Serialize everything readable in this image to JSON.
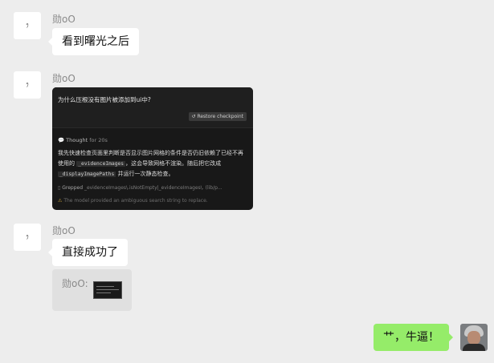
{
  "sender": {
    "name": "勋oO",
    "avatar_text": "ﾗ"
  },
  "messages": [
    {
      "text": "看到曙光之后"
    },
    {
      "screenshot": {
        "question": "为什么压根没有图片被添加到ui中?",
        "restore_label": "Restore checkpoint",
        "thought_label": "Thought",
        "thought_time": "for 20s",
        "body_parts": [
          "我先快速检查页面里判断是否显示图片网格的条件是否仍旧依赖了已经不再使用的 ",
          "_evidenceImages",
          "，这会导致网格不渲染。随后把它改成 ",
          "_displayImagePaths",
          " 并运行一次静态检查。"
        ],
        "grep_label": "Grepped",
        "grep_text": "_evidenceImages\\.isNotEmpty|_evidenceImages\\. (lib/p...",
        "warning": "The model provided an ambiguous search string to replace."
      }
    },
    {
      "text": "直接成功了",
      "quote_label": "勋oO:"
    },
    {
      "self_text": "艹，牛逼！"
    }
  ]
}
